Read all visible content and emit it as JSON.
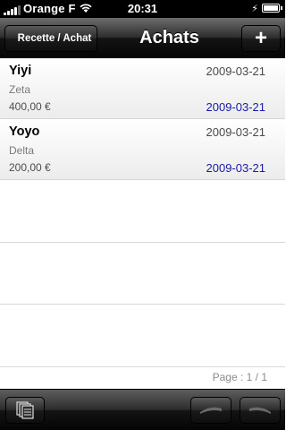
{
  "status_bar": {
    "carrier": "Orange F",
    "time": "20:31",
    "icons": [
      "signal-icon",
      "wifi-icon",
      "charging-icon",
      "battery-icon"
    ]
  },
  "nav": {
    "back_label": "Recette / Achat",
    "title": "Achats",
    "add_icon": "plus-icon",
    "add_label": "+"
  },
  "items": [
    {
      "name": "Yiyi",
      "date": "2009-03-21",
      "subtitle": "Zeta",
      "amount": "400,00 €",
      "date_secondary": "2009-03-21"
    },
    {
      "name": "Yoyo",
      "date": "2009-03-21",
      "subtitle": "Delta",
      "amount": "200,00 €",
      "date_secondary": "2009-03-21"
    }
  ],
  "page_info": "Page : 1 / 1",
  "toolbar": {
    "icons": [
      "pages-icon",
      "previous-page-icon",
      "next-page-icon"
    ]
  },
  "colors": {
    "bar_dark": "#141414",
    "secondary_date": "#1a1aa8",
    "row_separator": "#d6d6d6"
  }
}
